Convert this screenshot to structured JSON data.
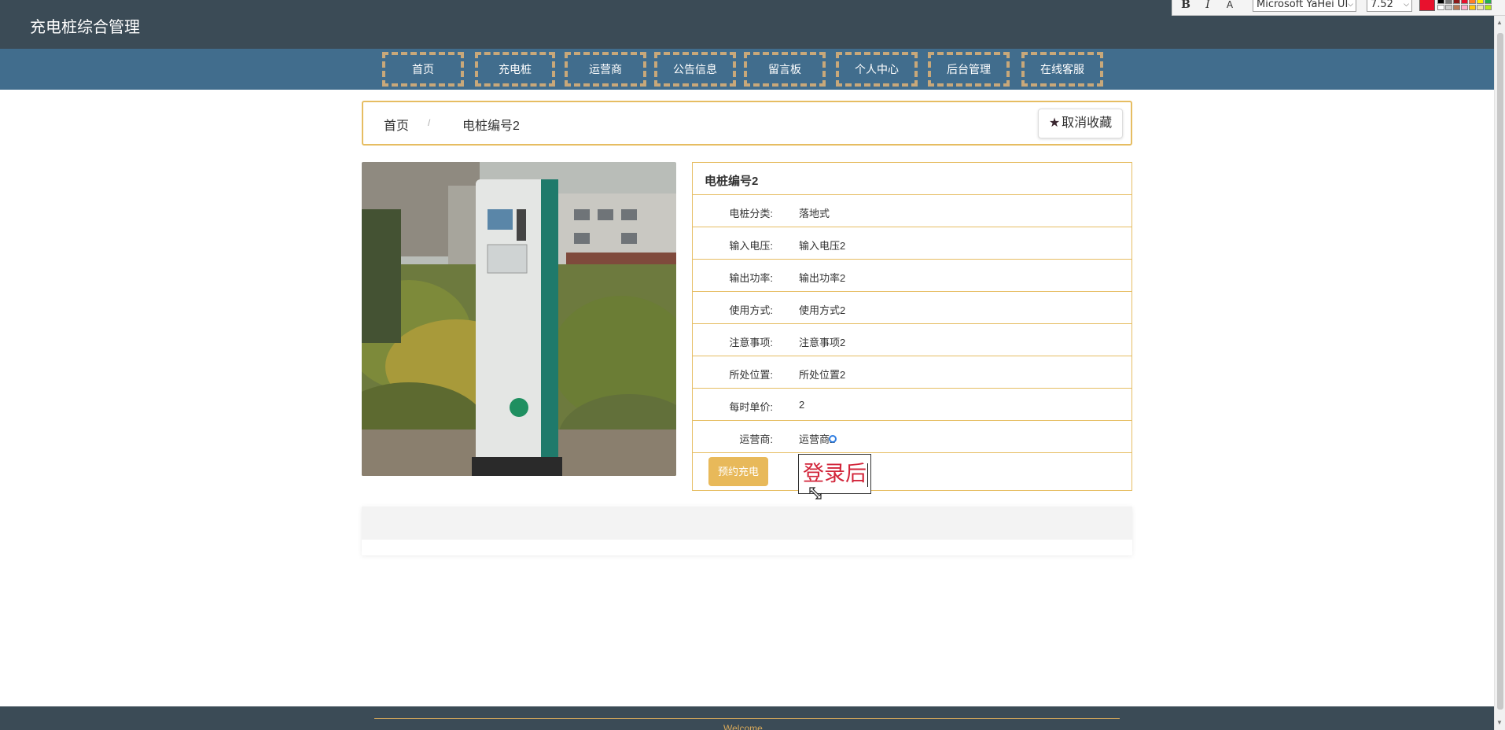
{
  "header": {
    "site_title": "充电桩综合管理"
  },
  "editor_toolbar": {
    "bold": "B",
    "italic": "I",
    "font_tool": "A",
    "font_name": "Microsoft YaHei UI",
    "font_size": "7.52",
    "text_color": "#e8112d"
  },
  "nav": {
    "items": [
      "首页",
      "充电桩",
      "运营商",
      "公告信息",
      "留言板",
      "个人中心",
      "后台管理",
      "在线客服"
    ]
  },
  "breadcrumb": {
    "home": "首页",
    "separator": "/",
    "current": "电桩编号2",
    "favorite_label": "取消收藏"
  },
  "detail": {
    "title": "电桩编号2",
    "rows": [
      {
        "label": "电桩分类:",
        "value": "落地式"
      },
      {
        "label": "输入电压:",
        "value": "输入电压2"
      },
      {
        "label": "输出功率:",
        "value": "输出功率2"
      },
      {
        "label": "使用方式:",
        "value": "使用方式2"
      },
      {
        "label": "注意事项:",
        "value": "注意事项2"
      },
      {
        "label": "所处位置:",
        "value": "所处位置2"
      },
      {
        "label": "每时单价:",
        "value": "2"
      },
      {
        "label": "运营商:",
        "value": "运营商2"
      }
    ],
    "book_button": "预约充电",
    "text_box": "登录后"
  },
  "footer": {
    "text": "Welcome"
  },
  "colors": {
    "topbar": "#3b4b56",
    "nav": "#416d8d",
    "accent": "#e6bd62",
    "button": "#e8b95a",
    "text_box": "#d2253a"
  }
}
